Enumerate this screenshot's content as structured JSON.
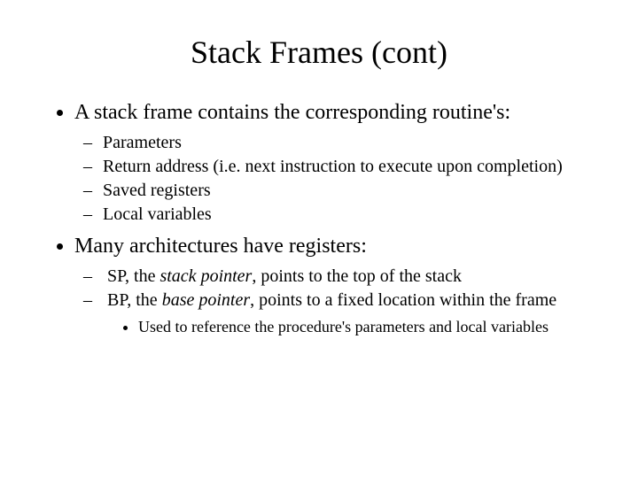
{
  "title": "Stack Frames (cont)",
  "b1": {
    "text": "A stack frame contains the corresponding routine's:",
    "sub": [
      "Parameters",
      "Return address (i.e. next instruction to execute upon completion)",
      "Saved registers",
      "Local variables"
    ]
  },
  "b2": {
    "text": "Many architectures have registers:",
    "sub1_pre": "SP, the ",
    "sub1_it": "stack pointer",
    "sub1_post": ", points to the top of the stack",
    "sub2_pre": "BP, the ",
    "sub2_it": "base pointer",
    "sub2_post": ", points to a fixed location within the frame",
    "sub2_sub": "Used to reference the procedure's parameters and local variables"
  }
}
